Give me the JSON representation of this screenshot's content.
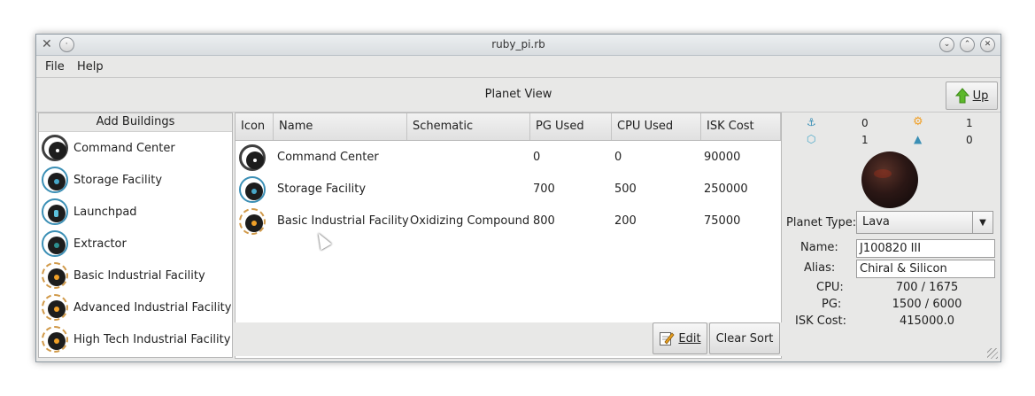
{
  "window": {
    "title": "ruby_pi.rb"
  },
  "menu": {
    "file": "File",
    "help": "Help"
  },
  "header": {
    "title": "Planet View",
    "up_label": "Up"
  },
  "add_buildings": {
    "title": "Add Buildings",
    "items": [
      {
        "label": "Command Center",
        "icon": "command-center-icon"
      },
      {
        "label": "Storage Facility",
        "icon": "storage-facility-icon"
      },
      {
        "label": "Launchpad",
        "icon": "launchpad-icon"
      },
      {
        "label": "Extractor",
        "icon": "extractor-icon"
      },
      {
        "label": "Basic Industrial Facility",
        "icon": "basic-industrial-icon"
      },
      {
        "label": "Advanced Industrial Facility",
        "icon": "advanced-industrial-icon"
      },
      {
        "label": "High Tech Industrial Facility",
        "icon": "high-tech-industrial-icon"
      }
    ]
  },
  "table": {
    "columns": [
      "Icon",
      "Name",
      "Schematic",
      "PG Used",
      "CPU Used",
      "ISK Cost"
    ],
    "rows": [
      {
        "name": "Command Center",
        "schematic": "",
        "pg": "0",
        "cpu": "0",
        "isk": "90000"
      },
      {
        "name": "Storage Facility",
        "schematic": "",
        "pg": "700",
        "cpu": "500",
        "isk": "250000"
      },
      {
        "name": "Basic Industrial Facility",
        "schematic": "Oxidizing Compound",
        "pg": "800",
        "cpu": "200",
        "isk": "75000"
      }
    ]
  },
  "actions": {
    "edit_label": "Edit",
    "clear_sort_label": "Clear Sort"
  },
  "stats": {
    "launchpads": "0",
    "factories": "1",
    "storage": "1",
    "extractors": "0"
  },
  "planet": {
    "type_label": "Planet Type:",
    "type_value": "Lava",
    "name_label": "Name:",
    "name_value": "J100820 III",
    "alias_label": "Alias:",
    "alias_value": "Chiral & Silicon",
    "cpu_label": "CPU:",
    "cpu_value": "700 / 1675",
    "pg_label": "PG:",
    "pg_value": "1500 / 6000",
    "isk_label": "ISK Cost:",
    "isk_value": "415000.0"
  },
  "colors": {
    "accent_blue": "#3b8fb5",
    "accent_orange": "#d19a4a",
    "up_arrow": "#5cb82a"
  }
}
